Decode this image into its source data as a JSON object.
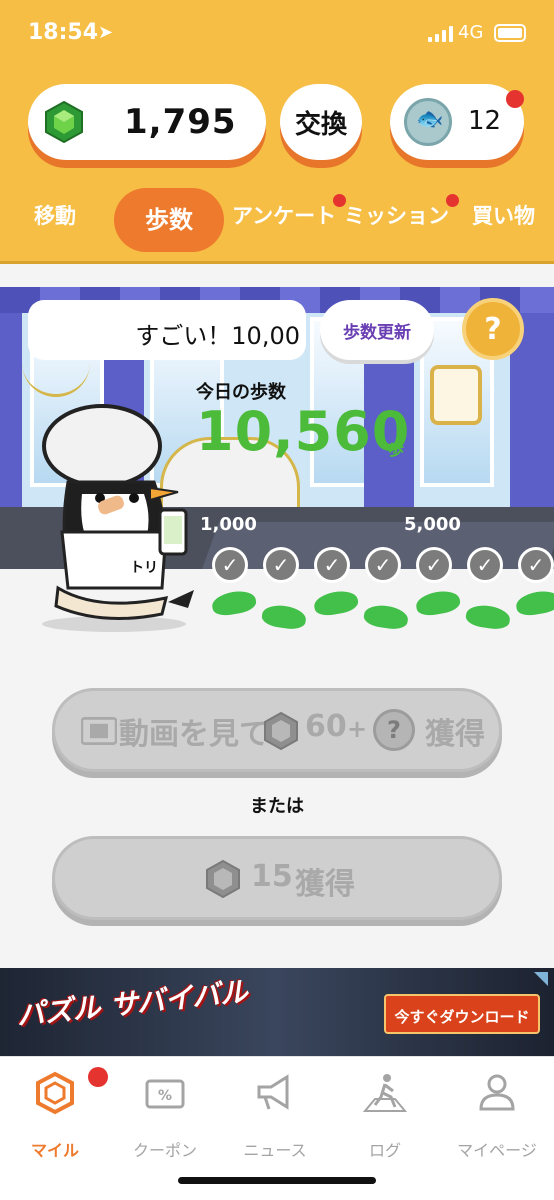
{
  "status_bar": {
    "time": "18:54",
    "network": "4G"
  },
  "header": {
    "gem_balance": "1,795",
    "exchange_label": "交換",
    "coin_count": "12"
  },
  "tabs": [
    {
      "label": "移動"
    },
    {
      "label": "歩数"
    },
    {
      "label": "アンケート"
    },
    {
      "label": "ミッション"
    },
    {
      "label": "買い物"
    }
  ],
  "scene": {
    "bubble_text": "すごい！10,00",
    "update_button": "歩数更新",
    "help_button": "?",
    "today_label": "今日の歩数",
    "today_steps": "10,560",
    "steps_unit": "歩",
    "milestones": [
      "1,000",
      "5,000"
    ],
    "shirt_text": "トリ"
  },
  "actions": {
    "video_button": {
      "text_a": "動画を見て",
      "gems": "60",
      "plus": "+",
      "mystery": "?",
      "text_b": "獲得"
    },
    "or_label": "または",
    "earn_button": {
      "gems": "15",
      "text": "獲得"
    }
  },
  "ad_banner": {
    "title": "パズル サバイバル",
    "cta": "今すぐダウンロード"
  },
  "bottom_nav": [
    {
      "label": "マイル",
      "icon": "hexagon-gem-icon"
    },
    {
      "label": "クーポン",
      "icon": "coupon-icon"
    },
    {
      "label": "ニュース",
      "icon": "megaphone-icon"
    },
    {
      "label": "ログ",
      "icon": "walking-person-icon"
    },
    {
      "label": "マイページ",
      "icon": "person-icon"
    }
  ],
  "colors": {
    "header_bg": "#f6be45",
    "accent_orange": "#ee7a2d",
    "steps_green": "#4cbb3a",
    "badge_red": "#e53330",
    "update_purple": "#6a3fb3"
  }
}
